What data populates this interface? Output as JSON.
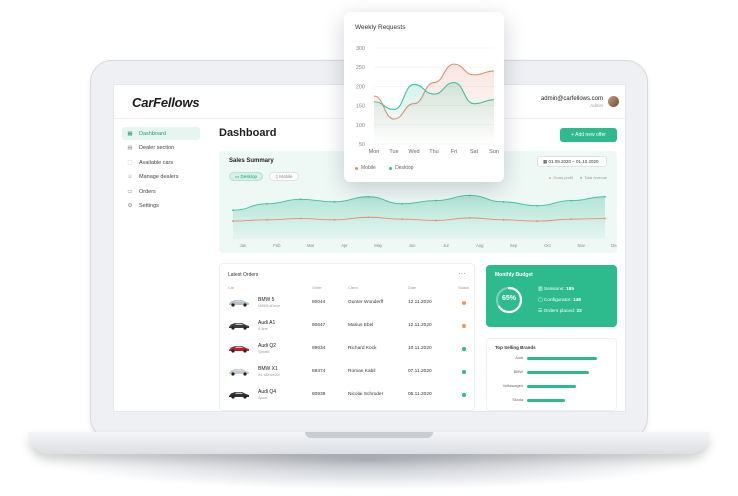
{
  "app": {
    "logo": "CarFellows",
    "user_email": "admin@carfellows.com",
    "user_role": "Admin"
  },
  "sidebar": {
    "items": [
      {
        "label": "Dashboard",
        "icon": "dashboard-icon",
        "active": true
      },
      {
        "label": "Dealer section",
        "icon": "dealer-icon",
        "active": false
      },
      {
        "label": "Available cars",
        "icon": "car-icon",
        "active": false
      },
      {
        "label": "Manage dealers",
        "icon": "users-icon",
        "active": false
      },
      {
        "label": "Orders",
        "icon": "cart-icon",
        "active": false
      },
      {
        "label": "Settings",
        "icon": "gear-icon",
        "active": false
      }
    ]
  },
  "main": {
    "title": "Dashboard",
    "add_button": "+ Add new offer"
  },
  "sales_summary": {
    "title": "Sales Summary",
    "tab_desktop": "Desktop",
    "tab_mobile": "Mobile",
    "date_range": "01.09.2020 – 01.10.2020",
    "legend_gross": "Gross profit",
    "legend_total": "Total revenue"
  },
  "orders": {
    "title": "Latest Orders",
    "columns": [
      "Car",
      "Order",
      "Client",
      "Date",
      "Status"
    ],
    "rows": [
      {
        "name": "BMW 5",
        "sub": "M550i xDrive",
        "order": "80044",
        "client": "Gunter Wonderff",
        "date": "12.11.2020",
        "status_color": "#f2994a",
        "car_color": "#b9bec4"
      },
      {
        "name": "Audi A1",
        "sub": "S-line",
        "order": "80647",
        "client": "Marius Ebel",
        "date": "12.11.2020",
        "status_color": "#f2994a",
        "car_color": "#3a3d42"
      },
      {
        "name": "Audi Q2",
        "sub": "Sportb.",
        "order": "89634",
        "client": "Richard Kock",
        "date": "10.11.2020",
        "status_color": "#2dba8c",
        "car_color": "#b3262e"
      },
      {
        "name": "BMW X1",
        "sub": "X1 sDrive20i",
        "order": "89474",
        "client": "Roman Kabil",
        "date": "07.11.2020",
        "status_color": "#2dba8c",
        "car_color": "#c8ccd1"
      },
      {
        "name": "Audi Q4",
        "sub": "Sport",
        "order": "80938",
        "client": "Nicolai Schroder",
        "date": "05.11.2020",
        "status_color": "#2dba8c",
        "car_color": "#2f3236"
      }
    ]
  },
  "budget": {
    "title": "Monthly Budget",
    "percent": "65%",
    "percent_value": 0.65,
    "sessions_label": "Sessions:",
    "sessions_value": "185",
    "configurator_label": "Configurator:",
    "configurator_value": "148",
    "orders_label": "Orders placed:",
    "orders_value": "22"
  },
  "brands": {
    "title": "Top Selling Brands",
    "items": [
      {
        "label": "Audi",
        "value": 0.92
      },
      {
        "label": "BMW",
        "value": 0.82
      },
      {
        "label": "Volkswagen",
        "value": 0.64
      },
      {
        "label": "Skoda",
        "value": 0.5
      }
    ]
  },
  "chart_data": [
    {
      "type": "line",
      "title": "Weekly Requests",
      "categories": [
        "Mon",
        "Tue",
        "Wed",
        "Thu",
        "Fri",
        "Sat",
        "Sun"
      ],
      "ylim": [
        50,
        300
      ],
      "yticks": [
        50,
        100,
        150,
        200,
        250,
        300
      ],
      "series": [
        {
          "name": "Mobile",
          "color": "#e98a6f",
          "values": [
            175,
            115,
            155,
            210,
            258,
            230,
            240
          ]
        },
        {
          "name": "Desktop",
          "color": "#3cc1a0",
          "values": [
            160,
            140,
            205,
            180,
            210,
            155,
            165
          ]
        }
      ],
      "legend": "bottom"
    },
    {
      "type": "area",
      "title": "Sales Summary",
      "categories": [
        "Jan",
        "Feb",
        "Mar",
        "Apr",
        "May",
        "Jun",
        "Jul",
        "Aug",
        "Sep",
        "Oct",
        "Nov",
        "Dec"
      ],
      "series": [
        {
          "name": "Gross profit",
          "color": "#e98a6f",
          "values": [
            28,
            30,
            32,
            30,
            34,
            31,
            29,
            33,
            30,
            28,
            31,
            32
          ]
        },
        {
          "name": "Total revenue",
          "color": "#3cc1a0",
          "values": [
            45,
            55,
            62,
            58,
            66,
            55,
            60,
            68,
            58,
            52,
            60,
            66
          ]
        }
      ]
    }
  ]
}
